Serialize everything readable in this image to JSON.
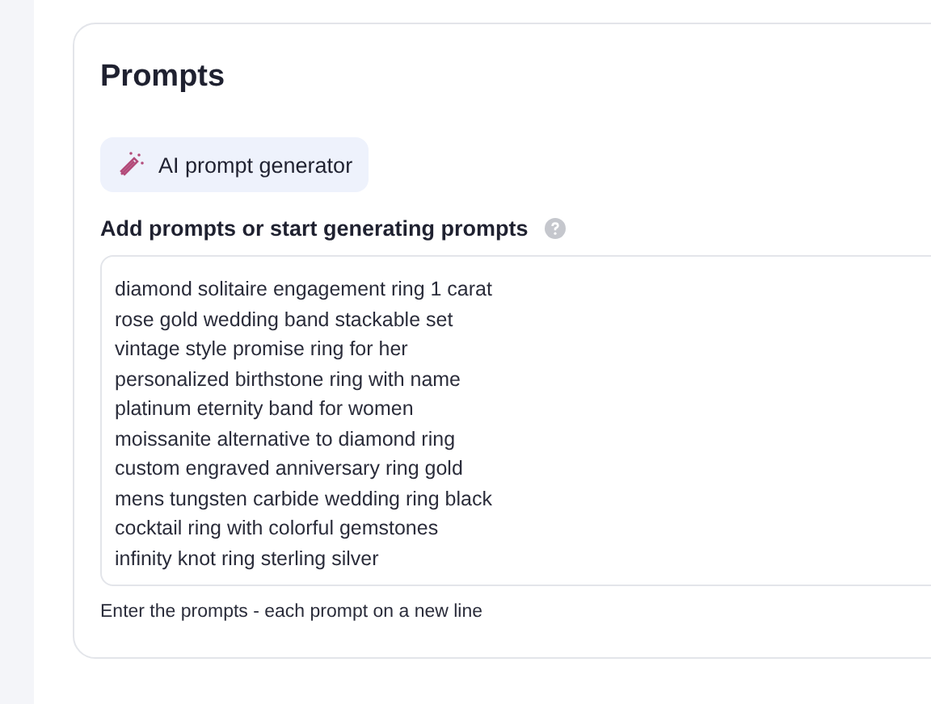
{
  "card": {
    "title": "Prompts",
    "generator_button": {
      "label": "AI prompt generator"
    },
    "field_label": "Add prompts or start generating prompts",
    "prompts": [
      "diamond solitaire engagement ring 1 carat",
      "rose gold wedding band stackable set",
      "vintage style promise ring for her",
      "personalized birthstone ring with name",
      "platinum eternity band for women",
      "moissanite alternative to diamond ring",
      "custom engraved anniversary ring gold",
      "mens tungsten carbide wedding ring black",
      "cocktail ring with colorful gemstones",
      "infinity knot ring sterling silver"
    ],
    "hint": "Enter the prompts - each prompt on a new line"
  }
}
